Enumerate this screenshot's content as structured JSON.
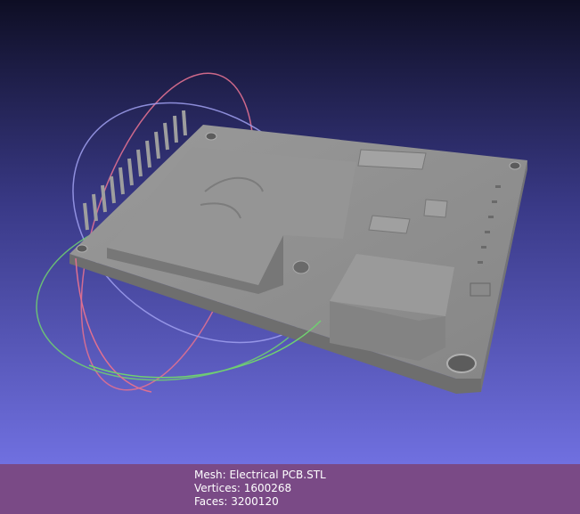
{
  "viewer": {
    "background_top": "#0e0e24",
    "background_bottom": "#7070e0",
    "mesh_color": "#8c8c8c",
    "trackball": {
      "colors": [
        "#e07090",
        "#9090f0",
        "#70d070"
      ]
    }
  },
  "info": {
    "color": "#7a4a86",
    "mesh_label": "Mesh:",
    "mesh_name": "Electrical PCB.STL",
    "vertices_label": "Vertices:",
    "vertices": "1600268",
    "faces_label": "Faces:",
    "faces": "3200120"
  }
}
